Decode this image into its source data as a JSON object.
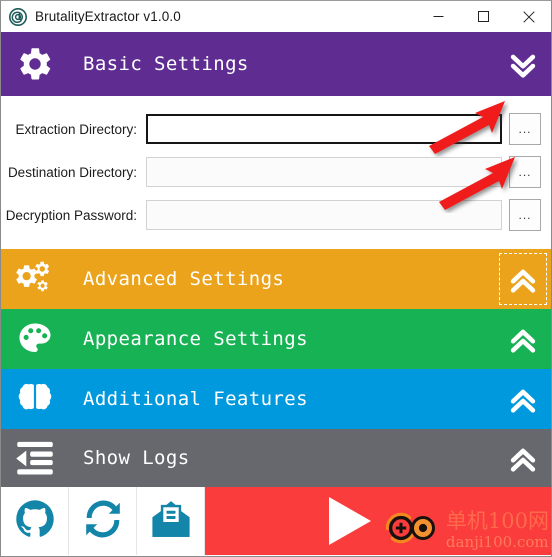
{
  "window": {
    "title": "BrutalityExtractor v1.0.0",
    "app_icon": "app-logo-icon",
    "controls": {
      "minimize": "minimize-icon",
      "maximize": "maximize-icon",
      "close": "close-icon"
    }
  },
  "sections": {
    "basic": {
      "label": "Basic Settings",
      "icon": "gear-icon",
      "toggle_icon": "double-chevron-down-icon",
      "color": "#5F2D91",
      "expanded": true
    },
    "advanced": {
      "label": "Advanced Settings",
      "icon": "gears-icon",
      "toggle_icon": "double-chevron-up-icon",
      "color": "#ECA31C",
      "expanded": false,
      "focused": true
    },
    "appearance": {
      "label": "Appearance Settings",
      "icon": "palette-icon",
      "toggle_icon": "double-chevron-up-icon",
      "color": "#16B254",
      "expanded": false
    },
    "additional": {
      "label": "Additional Features",
      "icon": "brain-icon",
      "toggle_icon": "double-chevron-up-icon",
      "color": "#0099DD",
      "expanded": false
    },
    "logs": {
      "label": "Show Logs",
      "icon": "indent-list-icon",
      "toggle_icon": "double-chevron-up-icon",
      "color": "#67686E",
      "expanded": false
    }
  },
  "form": {
    "rows": [
      {
        "label": "Extraction Directory:",
        "value": "",
        "placeholder": "",
        "browse_label": "...",
        "focused": true
      },
      {
        "label": "Destination Directory:",
        "value": "",
        "placeholder": "",
        "browse_label": "...",
        "focused": false
      },
      {
        "label": "Decryption Password:",
        "value": "",
        "placeholder": "",
        "browse_label": "...",
        "focused": false
      }
    ]
  },
  "bottombar": {
    "icons": [
      {
        "name": "github-icon",
        "color": "#1285A8"
      },
      {
        "name": "refresh-sync-icon",
        "color": "#1285A8"
      },
      {
        "name": "mail-envelope-icon",
        "color": "#1285A8"
      }
    ],
    "run_button": {
      "icon": "play-triangle-icon",
      "color": "#FA3C3C"
    }
  },
  "watermark": {
    "cn_text": "单机100网",
    "en_text": "danji100.com",
    "logo_icon": "danji-logo-icon",
    "color": "#FF6A4D"
  },
  "annotations": [
    {
      "name": "red-arrow-extraction-browse",
      "color": "#F01B1B"
    },
    {
      "name": "red-arrow-destination-browse",
      "color": "#F01B1B"
    }
  ]
}
